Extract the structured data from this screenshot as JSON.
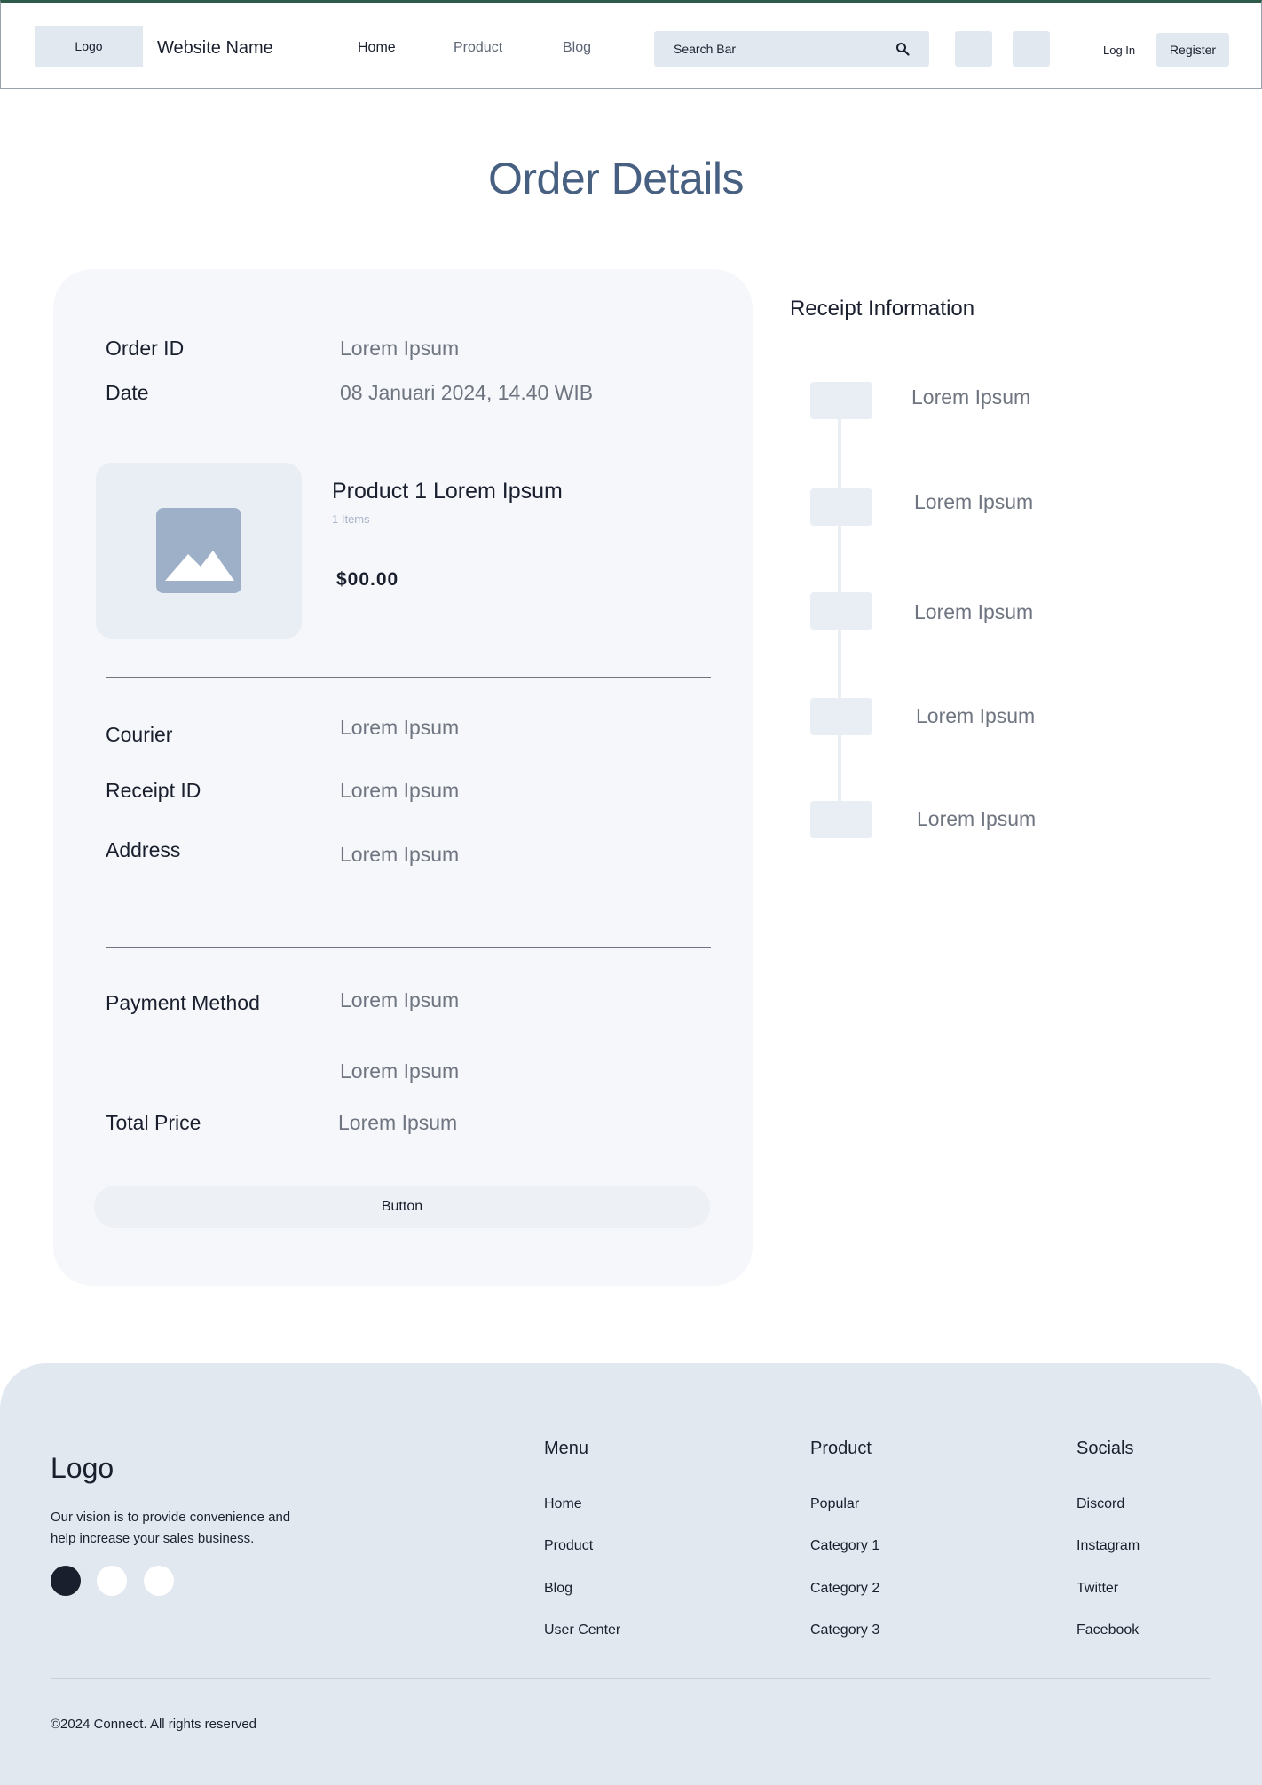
{
  "header": {
    "logo": "Logo",
    "website_name": "Website Name",
    "nav": [
      "Home",
      "Product",
      "Blog"
    ],
    "search_placeholder": "Search Bar",
    "login": "Log In",
    "register": "Register"
  },
  "page": {
    "title": "Order Details"
  },
  "order": {
    "order_id_label": "Order ID",
    "order_id_value": "Lorem Ipsum",
    "date_label": "Date",
    "date_value": "08 Januari 2024, 14.40 WIB",
    "product_name": "Product 1 Lorem Ipsum",
    "product_items": "1 Items",
    "product_price": "$00.00",
    "courier_label": "Courier",
    "courier_value": "Lorem Ipsum",
    "receipt_id_label": "Receipt ID",
    "receipt_id_value": "Lorem Ipsum",
    "address_label": "Address",
    "address_value": "Lorem Ipsum",
    "payment_method_label": "Payment Method",
    "payment_method_value": "Lorem Ipsum",
    "payment_extra_value": "Lorem Ipsum",
    "total_price_label": "Total Price",
    "total_price_value": "Lorem Ipsum",
    "button_label": "Button"
  },
  "receipt": {
    "title": "Receipt Information",
    "steps": [
      "Lorem Ipsum",
      "Lorem Ipsum",
      "Lorem Ipsum",
      "Lorem Ipsum",
      "Lorem Ipsum"
    ]
  },
  "footer": {
    "logo": "Logo",
    "vision": "Our vision is to provide convenience and help increase your sales business.",
    "social_dot_colors": [
      "#1a1f2e",
      "#ffffff",
      "#ffffff"
    ],
    "menu": {
      "heading": "Menu",
      "links": [
        "Home",
        "Product",
        "Blog",
        "User Center"
      ]
    },
    "product": {
      "heading": "Product",
      "links": [
        "Popular",
        "Category 1",
        "Category 2",
        "Category 3"
      ]
    },
    "socials": {
      "heading": "Socials",
      "links": [
        "Discord",
        "Instagram",
        "Twitter",
        "Facebook"
      ]
    },
    "copyright": "©2024 Connect. All rights reserved"
  },
  "colors": {
    "accent": "#475f80",
    "surface": "#e2e8f0",
    "card": "#f5f7fa"
  },
  "icons": {
    "search": "search-icon",
    "product_image": "image-placeholder-icon"
  }
}
